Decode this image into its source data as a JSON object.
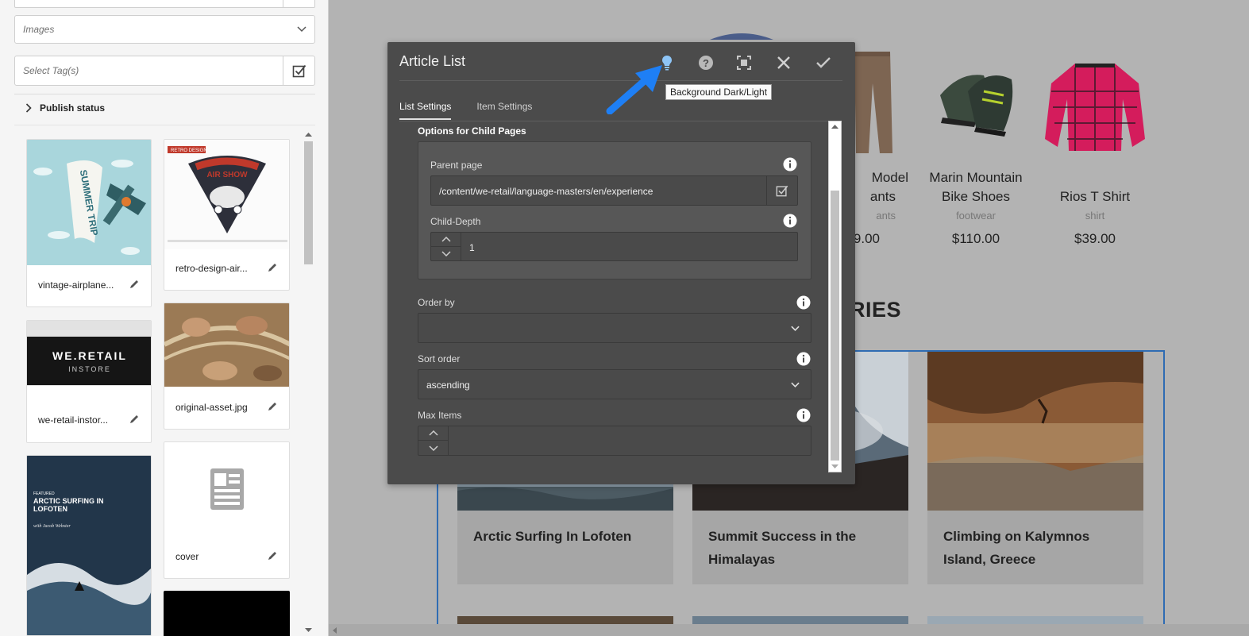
{
  "sidebar": {
    "asset_type": "Images",
    "tags_placeholder": "Select Tag(s)",
    "publish_status": "Publish status",
    "assets": [
      {
        "name": "vintage-airplane..."
      },
      {
        "name": "retro-design-air..."
      },
      {
        "name": "we-retail-instor..."
      },
      {
        "name": "original-asset.jpg"
      },
      {
        "name": "cover"
      }
    ],
    "thumb_text": {
      "summer_trip": "SUMMER TRIP",
      "air_show": "AIR SHOW",
      "retro_design": "RETRO DESIGN",
      "we_retail": "WE.RETAIL",
      "instore": "INSTORE",
      "featured": "FEATURED",
      "arctic_title": "ARCTIC SURFING IN LOFOTEN",
      "arctic_author": "with Jacob Webster"
    }
  },
  "preview": {
    "products": [
      {
        "name_line1": "Model",
        "name_line2": "ants",
        "category": "ants",
        "price": ".9.00"
      },
      {
        "name_line1": "Marin Mountain",
        "name_line2": "Bike Shoes",
        "category": "footwear",
        "price": "$110.00"
      },
      {
        "name_line1": "",
        "name_line2": "Rios T Shirt",
        "category": "shirt",
        "price": "$39.00"
      }
    ],
    "section_heading": "RIES",
    "articles": [
      {
        "title": "Arctic Surfing In Lofoten"
      },
      {
        "title": "Summit Success in the Himalayas"
      },
      {
        "title": "Climbing on Kalymnos Island, Greece"
      }
    ]
  },
  "dialog": {
    "title": "Article List",
    "tooltip": "Background Dark/Light",
    "tabs": [
      {
        "label": "List Settings",
        "active": true
      },
      {
        "label": "Item Settings",
        "active": false
      }
    ],
    "section_title": "Options for Child Pages",
    "parent_page": {
      "label": "Parent page",
      "value": "/content/we-retail/language-masters/en/experience"
    },
    "child_depth": {
      "label": "Child-Depth",
      "value": "1"
    },
    "order_by": {
      "label": "Order by",
      "value": ""
    },
    "sort_order": {
      "label": "Sort order",
      "value": "ascending"
    },
    "max_items": {
      "label": "Max Items",
      "value": ""
    }
  },
  "colors": {
    "accent_blue": "#1e7ff5",
    "frame_blue": "#2f6cb3",
    "dialog_bg": "#4b4b4b",
    "tooltip_bulb": "#8ec5f7"
  }
}
